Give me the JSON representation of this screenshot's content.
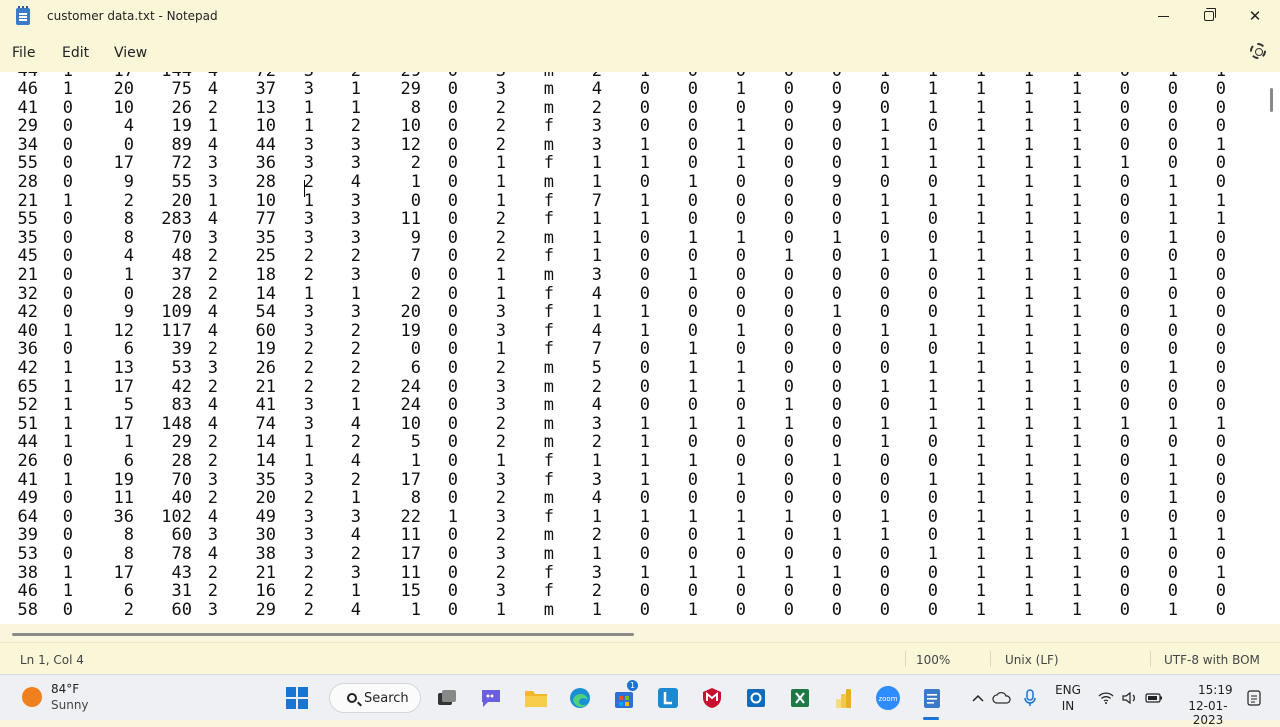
{
  "window": {
    "title": "customer data.txt - Notepad"
  },
  "menu": {
    "file": "File",
    "edit": "Edit",
    "view": "View"
  },
  "editor": {
    "partial_top_row": [
      "44",
      "1",
      "17",
      "144",
      "4",
      "72",
      "3",
      "2",
      "29",
      "0",
      "3",
      "m",
      "2",
      "1",
      "0",
      "0",
      "0",
      "0",
      "1",
      "1",
      "1",
      "1",
      "1",
      "0",
      "1",
      "1"
    ],
    "rows": [
      [
        "46",
        "1",
        "20",
        "75",
        "4",
        "37",
        "3",
        "1",
        "29",
        "0",
        "3",
        "m",
        "4",
        "0",
        "0",
        "1",
        "0",
        "0",
        "0",
        "1",
        "1",
        "1",
        "1",
        "0",
        "0",
        "0"
      ],
      [
        "41",
        "0",
        "10",
        "26",
        "2",
        "13",
        "1",
        "1",
        "8",
        "0",
        "2",
        "m",
        "2",
        "0",
        "0",
        "0",
        "0",
        "9",
        "0",
        "1",
        "1",
        "1",
        "1",
        "0",
        "0",
        "0"
      ],
      [
        "29",
        "0",
        "4",
        "19",
        "1",
        "10",
        "1",
        "2",
        "10",
        "0",
        "2",
        "f",
        "3",
        "0",
        "0",
        "1",
        "0",
        "0",
        "1",
        "0",
        "1",
        "1",
        "1",
        "0",
        "0",
        "0"
      ],
      [
        "34",
        "0",
        "0",
        "89",
        "4",
        "44",
        "3",
        "3",
        "12",
        "0",
        "2",
        "m",
        "3",
        "1",
        "0",
        "1",
        "0",
        "0",
        "1",
        "1",
        "1",
        "1",
        "1",
        "0",
        "0",
        "1"
      ],
      [
        "55",
        "0",
        "17",
        "72",
        "3",
        "36",
        "3",
        "3",
        "2",
        "0",
        "1",
        "f",
        "1",
        "1",
        "0",
        "1",
        "0",
        "0",
        "1",
        "1",
        "1",
        "1",
        "1",
        "1",
        "0",
        "0"
      ],
      [
        "28",
        "0",
        "9",
        "55",
        "3",
        "28",
        "2",
        "4",
        "1",
        "0",
        "1",
        "m",
        "1",
        "0",
        "1",
        "0",
        "0",
        "9",
        "0",
        "0",
        "1",
        "1",
        "1",
        "0",
        "1",
        "0"
      ],
      [
        "21",
        "1",
        "2",
        "20",
        "1",
        "10",
        "1",
        "3",
        "0",
        "0",
        "1",
        "f",
        "7",
        "1",
        "0",
        "0",
        "0",
        "0",
        "1",
        "1",
        "1",
        "1",
        "1",
        "0",
        "1",
        "1"
      ],
      [
        "55",
        "0",
        "8",
        "283",
        "4",
        "77",
        "3",
        "3",
        "11",
        "0",
        "2",
        "f",
        "1",
        "1",
        "0",
        "0",
        "0",
        "0",
        "1",
        "0",
        "1",
        "1",
        "1",
        "0",
        "1",
        "1"
      ],
      [
        "35",
        "0",
        "8",
        "70",
        "3",
        "35",
        "3",
        "3",
        "9",
        "0",
        "2",
        "m",
        "1",
        "0",
        "1",
        "1",
        "0",
        "1",
        "0",
        "0",
        "1",
        "1",
        "1",
        "0",
        "1",
        "0"
      ],
      [
        "45",
        "0",
        "4",
        "48",
        "2",
        "25",
        "2",
        "2",
        "7",
        "0",
        "2",
        "f",
        "1",
        "0",
        "0",
        "0",
        "1",
        "0",
        "1",
        "1",
        "1",
        "1",
        "1",
        "0",
        "0",
        "0"
      ],
      [
        "21",
        "0",
        "1",
        "37",
        "2",
        "18",
        "2",
        "3",
        "0",
        "0",
        "1",
        "m",
        "3",
        "0",
        "1",
        "0",
        "0",
        "0",
        "0",
        "0",
        "1",
        "1",
        "1",
        "0",
        "1",
        "0"
      ],
      [
        "32",
        "0",
        "0",
        "28",
        "2",
        "14",
        "1",
        "1",
        "2",
        "0",
        "1",
        "f",
        "4",
        "0",
        "0",
        "0",
        "0",
        "0",
        "0",
        "0",
        "1",
        "1",
        "1",
        "0",
        "0",
        "0"
      ],
      [
        "42",
        "0",
        "9",
        "109",
        "4",
        "54",
        "3",
        "3",
        "20",
        "0",
        "3",
        "f",
        "1",
        "1",
        "0",
        "0",
        "0",
        "1",
        "0",
        "0",
        "1",
        "1",
        "1",
        "0",
        "1",
        "0"
      ],
      [
        "40",
        "1",
        "12",
        "117",
        "4",
        "60",
        "3",
        "2",
        "19",
        "0",
        "3",
        "f",
        "4",
        "1",
        "0",
        "1",
        "0",
        "0",
        "1",
        "1",
        "1",
        "1",
        "1",
        "0",
        "0",
        "0"
      ],
      [
        "36",
        "0",
        "6",
        "39",
        "2",
        "19",
        "2",
        "2",
        "0",
        "0",
        "1",
        "f",
        "7",
        "0",
        "1",
        "0",
        "0",
        "0",
        "0",
        "0",
        "1",
        "1",
        "1",
        "0",
        "0",
        "0"
      ],
      [
        "42",
        "1",
        "13",
        "53",
        "3",
        "26",
        "2",
        "2",
        "6",
        "0",
        "2",
        "m",
        "5",
        "0",
        "1",
        "1",
        "0",
        "0",
        "0",
        "1",
        "1",
        "1",
        "1",
        "0",
        "1",
        "0"
      ],
      [
        "65",
        "1",
        "17",
        "42",
        "2",
        "21",
        "2",
        "2",
        "24",
        "0",
        "3",
        "m",
        "2",
        "0",
        "1",
        "1",
        "0",
        "0",
        "1",
        "1",
        "1",
        "1",
        "1",
        "0",
        "0",
        "0"
      ],
      [
        "52",
        "1",
        "5",
        "83",
        "4",
        "41",
        "3",
        "1",
        "24",
        "0",
        "3",
        "m",
        "4",
        "0",
        "0",
        "0",
        "1",
        "0",
        "0",
        "1",
        "1",
        "1",
        "1",
        "0",
        "0",
        "0"
      ],
      [
        "51",
        "1",
        "17",
        "148",
        "4",
        "74",
        "3",
        "4",
        "10",
        "0",
        "2",
        "m",
        "3",
        "1",
        "1",
        "1",
        "1",
        "0",
        "1",
        "1",
        "1",
        "1",
        "1",
        "1",
        "1",
        "1"
      ],
      [
        "44",
        "1",
        "1",
        "29",
        "2",
        "14",
        "1",
        "2",
        "5",
        "0",
        "2",
        "m",
        "2",
        "1",
        "0",
        "0",
        "0",
        "0",
        "1",
        "0",
        "1",
        "1",
        "1",
        "0",
        "0",
        "0"
      ],
      [
        "26",
        "0",
        "6",
        "28",
        "2",
        "14",
        "1",
        "4",
        "1",
        "0",
        "1",
        "f",
        "1",
        "1",
        "1",
        "0",
        "0",
        "1",
        "0",
        "0",
        "1",
        "1",
        "1",
        "0",
        "1",
        "0"
      ],
      [
        "41",
        "1",
        "19",
        "70",
        "3",
        "35",
        "3",
        "2",
        "17",
        "0",
        "3",
        "f",
        "3",
        "1",
        "0",
        "1",
        "0",
        "0",
        "0",
        "1",
        "1",
        "1",
        "1",
        "0",
        "1",
        "0"
      ],
      [
        "49",
        "0",
        "11",
        "40",
        "2",
        "20",
        "2",
        "1",
        "8",
        "0",
        "2",
        "m",
        "4",
        "0",
        "0",
        "0",
        "0",
        "0",
        "0",
        "0",
        "1",
        "1",
        "1",
        "0",
        "1",
        "0"
      ],
      [
        "64",
        "0",
        "36",
        "102",
        "4",
        "49",
        "3",
        "3",
        "22",
        "1",
        "3",
        "f",
        "1",
        "1",
        "1",
        "1",
        "1",
        "0",
        "1",
        "0",
        "1",
        "1",
        "1",
        "0",
        "0",
        "0"
      ],
      [
        "39",
        "0",
        "8",
        "60",
        "3",
        "30",
        "3",
        "4",
        "11",
        "0",
        "2",
        "m",
        "2",
        "0",
        "0",
        "1",
        "0",
        "1",
        "1",
        "0",
        "1",
        "1",
        "1",
        "1",
        "1",
        "1"
      ],
      [
        "53",
        "0",
        "8",
        "78",
        "4",
        "38",
        "3",
        "2",
        "17",
        "0",
        "3",
        "m",
        "1",
        "0",
        "0",
        "0",
        "0",
        "0",
        "0",
        "1",
        "1",
        "1",
        "1",
        "0",
        "0",
        "0"
      ],
      [
        "38",
        "1",
        "17",
        "43",
        "2",
        "21",
        "2",
        "3",
        "11",
        "0",
        "2",
        "f",
        "3",
        "1",
        "1",
        "1",
        "1",
        "1",
        "0",
        "0",
        "1",
        "1",
        "1",
        "0",
        "0",
        "1"
      ],
      [
        "46",
        "1",
        "6",
        "31",
        "2",
        "16",
        "2",
        "1",
        "15",
        "0",
        "3",
        "f",
        "2",
        "0",
        "0",
        "0",
        "0",
        "0",
        "0",
        "0",
        "1",
        "1",
        "1",
        "0",
        "0",
        "0"
      ],
      [
        "58",
        "0",
        "2",
        "60",
        "3",
        "29",
        "2",
        "4",
        "1",
        "0",
        "1",
        "m",
        "1",
        "0",
        "1",
        "0",
        "0",
        "0",
        "0",
        "0",
        "1",
        "1",
        "1",
        "0",
        "1",
        "0"
      ]
    ]
  },
  "status": {
    "position": "Ln 1, Col 4",
    "zoom": "100%",
    "line_ending": "Unix (LF)",
    "encoding": "UTF-8 with BOM"
  },
  "taskbar": {
    "temperature": "84°F",
    "condition": "Sunny",
    "search_label": "Search",
    "store_badge": "1",
    "language_1": "ENG",
    "language_2": "IN",
    "time": "15:19",
    "date": "12-01-2023",
    "icons": [
      "start-icon",
      "search-icon",
      "task-view-icon",
      "teams-chat-icon",
      "file-explorer-icon",
      "edge-icon",
      "microsoft-store-icon",
      "libre-icon",
      "mcafee-icon",
      "outlook-icon",
      "excel-icon",
      "power-bi-icon",
      "zoom-icon",
      "notepad-icon"
    ]
  }
}
